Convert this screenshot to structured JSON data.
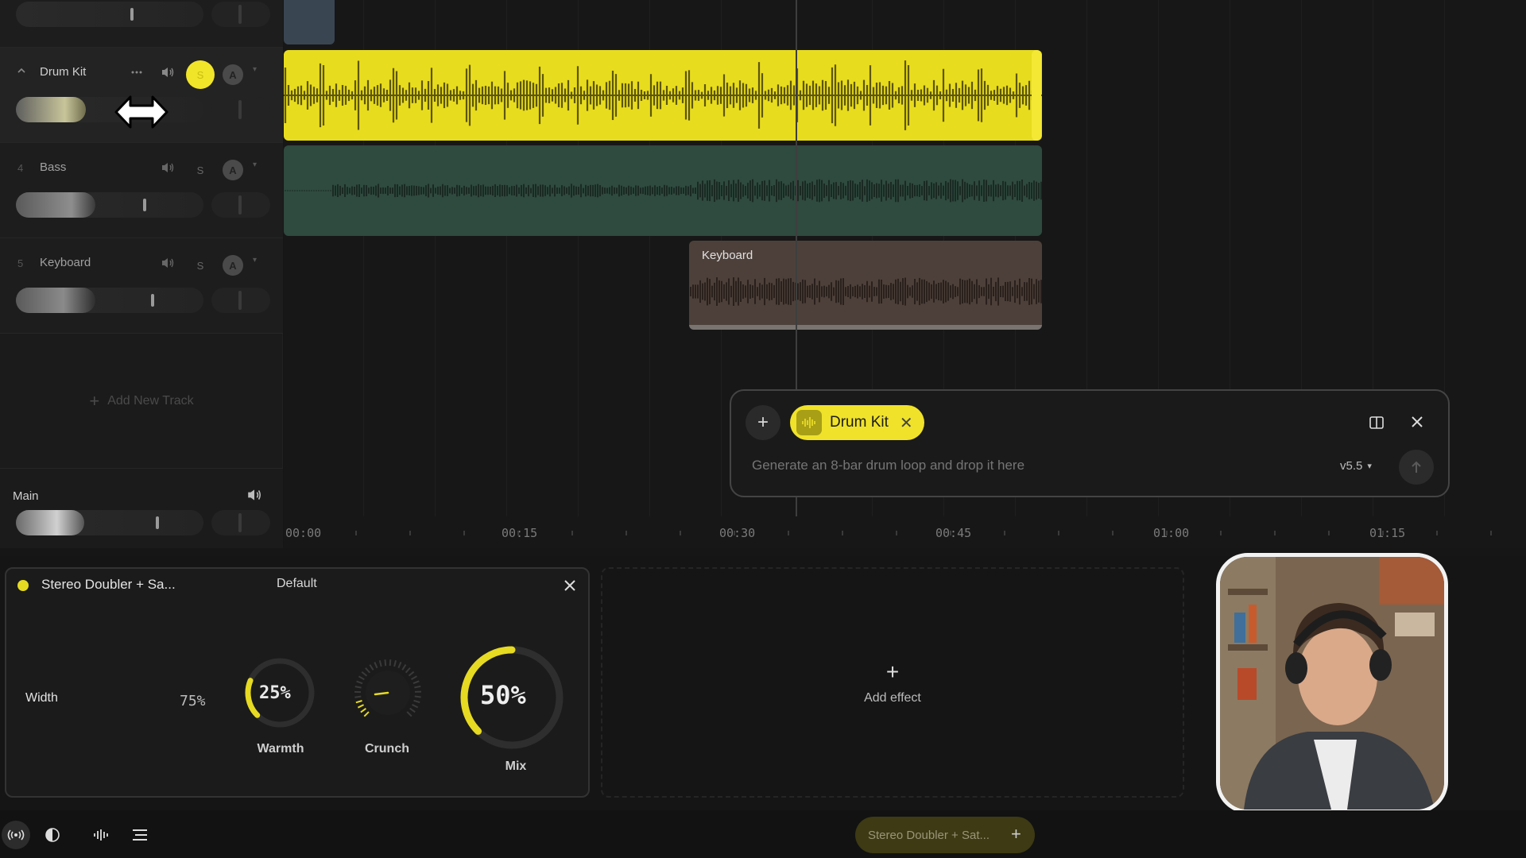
{
  "colors": {
    "accent": "#f1e52a",
    "bass_clip": "#2f4a3f",
    "keyboard_clip": "#4d403a",
    "background": "#161616"
  },
  "tracks": [
    {
      "number": "",
      "name": "Drum Kit",
      "solo": "S",
      "arm": "A",
      "active": true,
      "fader_level": 0.3
    },
    {
      "number": "4",
      "name": "Bass",
      "solo": "S",
      "arm": "A",
      "active": false,
      "fader_level": 0.56
    },
    {
      "number": "5",
      "name": "Keyboard",
      "solo": "S",
      "arm": "A",
      "active": false,
      "fader_level": 0.6
    }
  ],
  "add_track_label": "Add New Track",
  "main": {
    "label": "Main",
    "fader_level": 0.62
  },
  "clips": {
    "keyboard_label": "Keyboard"
  },
  "ruler": {
    "labels": [
      "00:00",
      "00:15",
      "00:30",
      "00:45",
      "01:00",
      "01:15"
    ]
  },
  "prompt": {
    "chip_label": "Drum Kit",
    "placeholder": "Generate an 8-bar drum loop and drop it here",
    "model": "v5.5",
    "model_caret": "▾"
  },
  "effect": {
    "name": "Stereo Doubler + Sa...",
    "preset": "Default",
    "width_label": "Width",
    "width_value": "75%",
    "warmth_value": "25%",
    "warmth_label": "Warmth",
    "crunch_label": "Crunch",
    "mix_value": "50%",
    "mix_label": "Mix",
    "warmth_level": 0.25,
    "crunch_level": 0.0,
    "mix_level": 0.5
  },
  "add_effect_label": "Add effect",
  "footer": {
    "effect_pill": "Stereo Doubler + Sat..."
  },
  "icons": [
    "chevron-up-icon",
    "more-icon",
    "speaker-icon",
    "resize-cursor-icon",
    "plus-icon",
    "waveform-icon",
    "close-icon",
    "panel-icon",
    "send-arrow-icon",
    "broadcast-icon",
    "contrast-icon",
    "menu-icon"
  ]
}
